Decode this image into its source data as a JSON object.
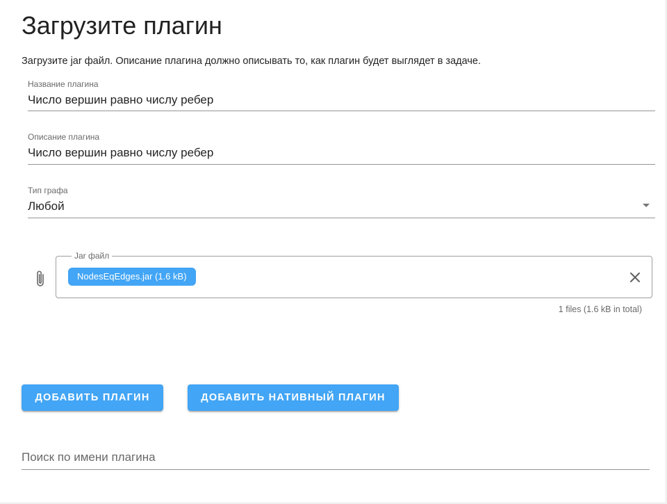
{
  "page": {
    "title": "Загрузите плагин",
    "description": "Загрузите jar файл. Описание плагина должно описывать то, как плагин будет выглядет в задаче."
  },
  "form": {
    "name_field": {
      "label": "Название плагина",
      "value": "Число вершин равно числу ребер"
    },
    "description_field": {
      "label": "Описание плагина",
      "value": "Число вершин равно числу ребер"
    },
    "graph_type_select": {
      "label": "Тип графа",
      "selected": "Любой"
    },
    "file_input": {
      "label": "Jar файл",
      "chip": "NodesEqEdges.jar (1.6 kB)",
      "summary": "1 files (1.6 kB in total)"
    }
  },
  "actions": {
    "add_plugin": "Добавить плагин",
    "add_native_plugin": "Добавить нативный плагин"
  },
  "search": {
    "placeholder": "Поиск по имени плагина"
  },
  "colors": {
    "accent": "#42a5f5"
  },
  "icons": {
    "attach": "paperclip-icon",
    "clear": "close-icon",
    "dropdown": "caret-down-icon"
  }
}
